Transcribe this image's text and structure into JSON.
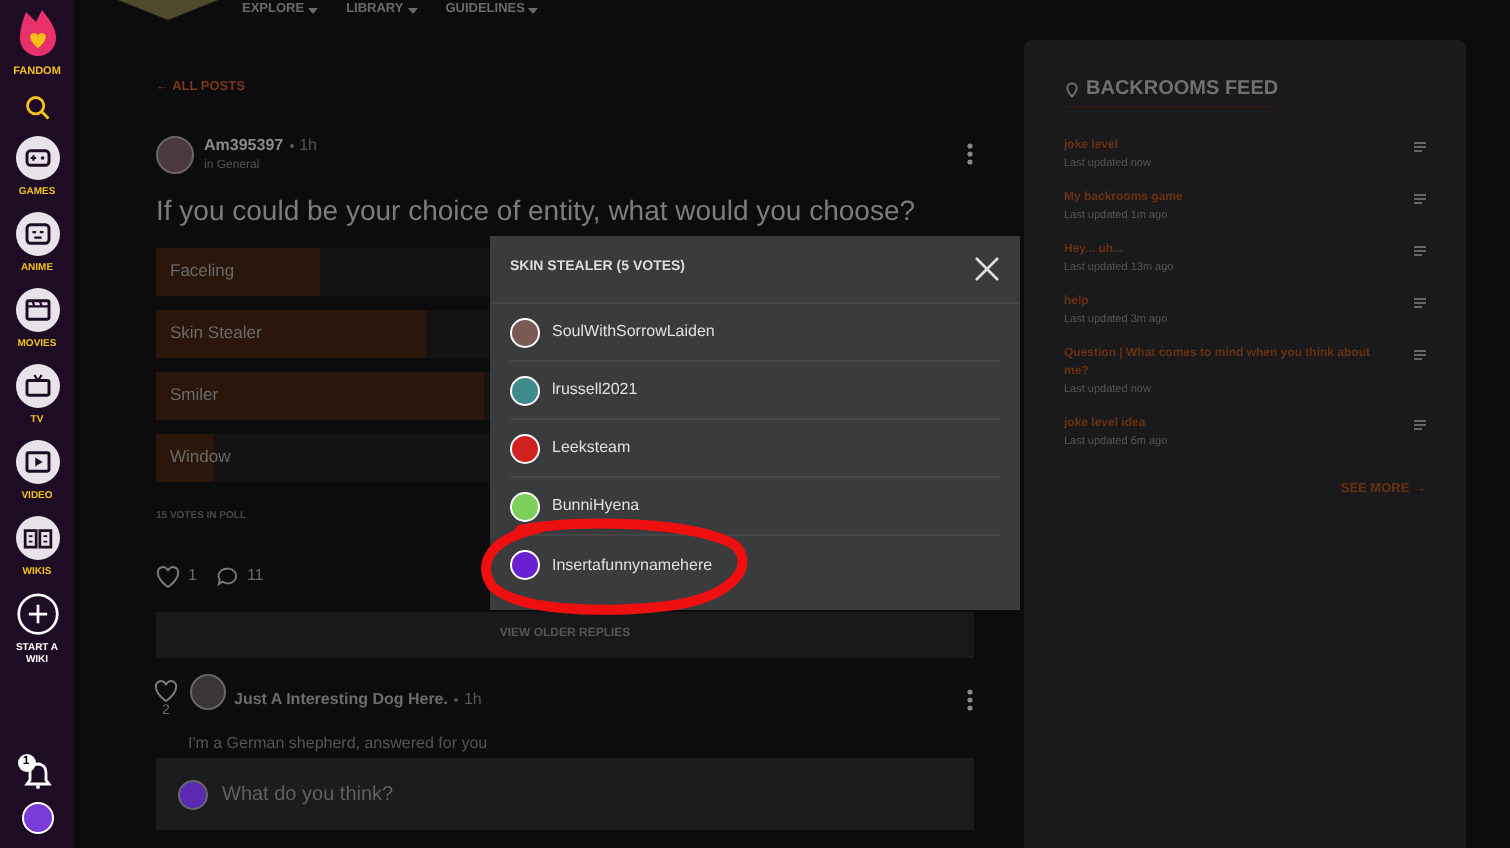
{
  "sidebar": {
    "logo_label": "FANDOM",
    "items": [
      {
        "kind": "games",
        "label": "GAMES"
      },
      {
        "kind": "anime",
        "label": "ANIME"
      },
      {
        "kind": "movies",
        "label": "MOVIES"
      },
      {
        "kind": "tv",
        "label": "TV"
      },
      {
        "kind": "video",
        "label": "VIDEO"
      },
      {
        "kind": "wikis",
        "label": "WIKIS"
      },
      {
        "kind": "start",
        "label": "START A WIKI"
      }
    ],
    "notification_count": "1"
  },
  "top_nav": [
    "EXPLORE",
    "LIBRARY",
    "GUIDELINES"
  ],
  "back_link": "← ALL POSTS",
  "post": {
    "author": "Am395397",
    "time": "1h",
    "category": "in General",
    "title": "If you could be your choice of entity, what would you choose?",
    "poll": [
      {
        "label": "Faceling",
        "level": 0.2
      },
      {
        "label": "Skin Stealer",
        "level": 0.33
      },
      {
        "label": "Smiler",
        "level": 0.4
      },
      {
        "label": "Window",
        "level": 0.07
      }
    ],
    "votes": "15 VOTES IN POLL",
    "likes": "1",
    "comments": "11"
  },
  "view_older": "VIEW OLDER REPLIES",
  "reply": {
    "likes": "2",
    "author": "Just A Interesting Dog Here.",
    "time": "1h",
    "text": "I'm a German shepherd, answered for you"
  },
  "comment_placeholder": "What do you think?",
  "modal": {
    "title": "SKIN STEALER (5 VOTES)",
    "voters": [
      {
        "name": "SoulWithSorrowLaiden",
        "color": "#7a5a55"
      },
      {
        "name": "lrussell2021",
        "color": "#3f8a8a"
      },
      {
        "name": "Leeksteam",
        "color": "#d02020"
      },
      {
        "name": "BunniHyena",
        "color": "#7ccf5a"
      },
      {
        "name": "Insertafunnynamehere",
        "color": "#6a20d0"
      }
    ]
  },
  "feed": {
    "title": "BACKROOMS FEED",
    "items": [
      {
        "title": "joke level",
        "updated": "Last updated now"
      },
      {
        "title": "My backrooms game",
        "updated": "Last updated 1m ago"
      },
      {
        "title": "Hey... uh...",
        "updated": "Last updated 13m ago"
      },
      {
        "title": "help",
        "updated": "Last updated 3m ago"
      },
      {
        "title": "Question | What comes to mind when you think about me?",
        "updated": "Last updated now"
      },
      {
        "title": "joke level idea",
        "updated": "Last updated 6m ago"
      }
    ],
    "see_more": "SEE MORE →"
  }
}
